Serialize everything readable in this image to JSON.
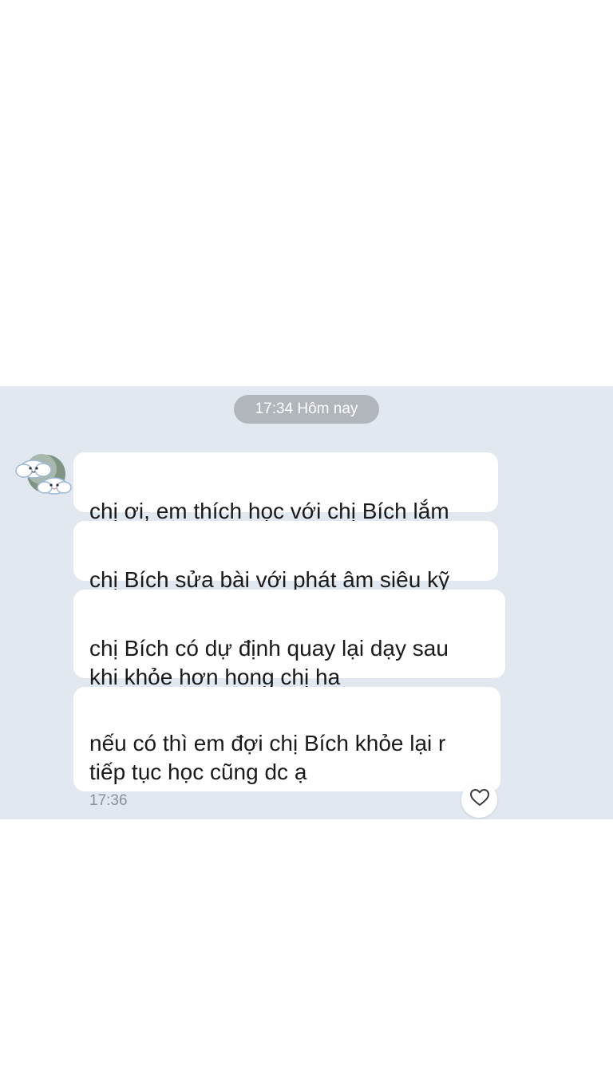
{
  "chat": {
    "timestamp_divider": "17:34 Hôm nay",
    "messages": [
      {
        "text": "chị ơi, em thích học với chị Bích lắm"
      },
      {
        "text": "chị Bích sửa bài với phát âm siêu kỹ"
      },
      {
        "text": "chị Bích có dự định quay lại dạy sau\nkhi khỏe hơn hong chị ha"
      },
      {
        "text": "nếu có thì em đợi chị Bích khỏe lại r\ntiếp tục học cũng dc ạ",
        "time": "17:36"
      }
    ],
    "avatar_icon": "cloud-avatar-icon",
    "reaction_icon": "heart-outline-icon"
  },
  "colors": {
    "chat_background": "#e2e8f0",
    "bubble": "#ffffff",
    "time_pill": "#b1b6bd"
  }
}
